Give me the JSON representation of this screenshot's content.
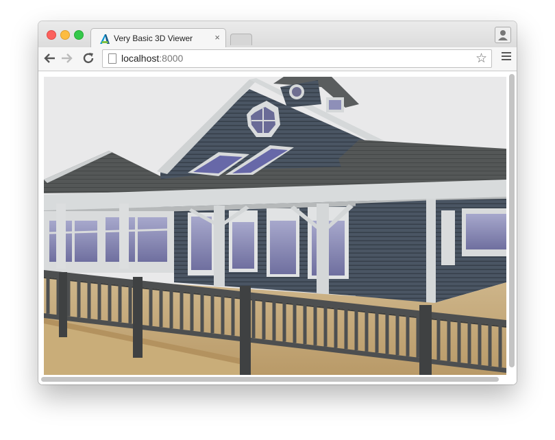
{
  "browser": {
    "tab_title": "Very Basic 3D Viewer",
    "tab_close": "×",
    "url_host": "localhost",
    "url_port": ":8000"
  },
  "icons": {
    "back": "arrow-left-icon",
    "forward": "arrow-right-icon",
    "reload": "reload-icon",
    "bookmark": "star-icon",
    "menu": "hamburger-menu-icon",
    "profile": "person-icon",
    "favicon": "autodesk-logo-icon"
  },
  "colors": {
    "sky": "#e9e9ea",
    "siding": "#4a5563",
    "roof": "#505353",
    "trim": "#d7d9da",
    "deck": "#c4a777",
    "railing": "#4d4f50",
    "glass": "#8e8fb8"
  }
}
